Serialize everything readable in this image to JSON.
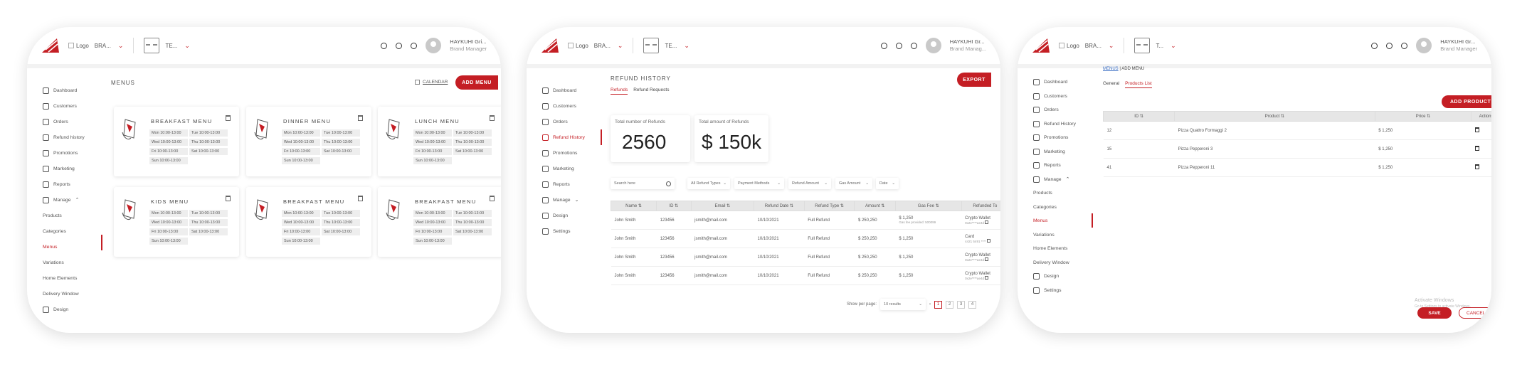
{
  "header": {
    "logo_text": "Logo",
    "brand": "BRA...",
    "brand_short": "BRA...",
    "team": "TE...",
    "team_short": "T...",
    "user_name_1": "HAYKUHI Gri...",
    "user_name_2": "HAYKUHI Gr...",
    "user_name_3": "HAYKUHI Gr...",
    "user_role_1": "Brand Manager",
    "user_role_2": "Brand Manag...",
    "user_role_3": "Brand Manager"
  },
  "sidebar": {
    "dashboard": "Dashboard",
    "customers": "Customers",
    "orders": "Orders",
    "refund_history": "Refund history",
    "refund_history_cap": "Refund History",
    "promotions": "Promotions",
    "marketing": "Marketing",
    "reports": "Reports",
    "manage": "Manage",
    "products": "Products",
    "categories": "Categories",
    "menus": "Menus",
    "variations": "Variations",
    "home_elements": "Home Elements",
    "delivery_window": "Delivery Window",
    "design": "Design",
    "settings": "Settings"
  },
  "menus_screen": {
    "title": "MENUS",
    "calendar": "CALENDAR",
    "add_menu": "ADD MENU",
    "cards": [
      {
        "title": "BREAKFAST MENU",
        "hours": [
          "Mon 10:00-13:00",
          "Tue 10:00-13:00",
          "Wed 10:00-13:00",
          "Thu 10:00-13:00",
          "Fri 10:00-13:00",
          "Sat 10:00-13:00",
          "Sun 10:00-13:00"
        ]
      },
      {
        "title": "DINNER MENU",
        "hours": [
          "Mon 10:00-13:00",
          "Tue 10:00-13:00",
          "Wed 10:00-13:00",
          "Thu 10:00-13:00",
          "Fri 10:00-13:00",
          "Sat 10:00-13:00",
          "Sun 10:00-13:00"
        ]
      },
      {
        "title": "LUNCH MENU",
        "hours": [
          "Mon 10:00-13:00",
          "Tue 10:00-13:00",
          "Wed 10:00-13:00",
          "Thu 10:00-13:00",
          "Fri 10:00-13:00",
          "Sat 10:00-13:00",
          "Sun 10:00-13:00"
        ]
      },
      {
        "title": "KIDS MENU",
        "hours": [
          "Mon 10:00-13:00",
          "Tue 10:00-13:00",
          "Wed 10:00-13:00",
          "Thu 10:00-13:00",
          "Fri 10:00-13:00",
          "Sat 10:00-13:00",
          "Sun 10:00-13:00"
        ]
      },
      {
        "title": "BREAKFAST MENU",
        "hours": [
          "Mon 10:00-13:00",
          "Tue 10:00-13:00",
          "Wed 10:00-13:00",
          "Thu 10:00-13:00",
          "Fri 10:00-13:00",
          "Sat 10:00-13:00",
          "Sun 10:00-13:00"
        ]
      },
      {
        "title": "BREAKFAST MENU",
        "hours": [
          "Mon 10:00-13:00",
          "Tue 10:00-13:00",
          "Wed 10:00-13:00",
          "Thu 10:00-13:00",
          "Fri 10:00-13:00",
          "Sat 10:00-13:00",
          "Sun 10:00-13:00"
        ]
      }
    ]
  },
  "refund_screen": {
    "title": "REFUND HISTORY",
    "export": "EXPORT",
    "tab_refunds": "Refunds",
    "tab_requests": "Refund Requests",
    "total_refunds_label": "Total number of Refunds",
    "total_refunds_value": "2560",
    "total_amount_label": "Total amount of Refunds",
    "total_amount_value": "$ 150k",
    "search_placeholder": "Search here",
    "filters": [
      "All Refund Types",
      "Payment Methods",
      "Refund Amount",
      "Gas Amount",
      "Date"
    ],
    "columns": [
      "Name ⇅",
      "ID ⇅",
      "Email ⇅",
      "Refund Date ⇅",
      "Refund Type ⇅",
      "Amount ⇅",
      "Gas Fee ⇅",
      "Refunded To"
    ],
    "rows": [
      {
        "name": "John Smith",
        "id": "123456",
        "email": "jsmith@mail.com",
        "date": "10/10/2021",
        "type": "Full Refund",
        "amount": "$ 250,250",
        "gas": "$ 1,250",
        "gas_note": "Gas fee provided: 500099",
        "to": "Crypto Wallet",
        "to_note": "0x2e****ae4d"
      },
      {
        "name": "John Smith",
        "id": "123456",
        "email": "jsmith@mail.com",
        "date": "10/10/2021",
        "type": "Full Refund",
        "amount": "$ 250,250",
        "gas": "$ 1,250",
        "gas_note": "",
        "to": "Card",
        "to_note": "4421 5491 ****"
      },
      {
        "name": "John Smith",
        "id": "123456",
        "email": "jsmith@mail.com",
        "date": "10/10/2021",
        "type": "Full Refund",
        "amount": "$ 250,250",
        "gas": "$ 1,250",
        "gas_note": "",
        "to": "Crypto Wallet",
        "to_note": "0x2e****ae4d"
      },
      {
        "name": "John Smith",
        "id": "123456",
        "email": "jsmith@mail.com",
        "date": "10/10/2021",
        "type": "Full Refund",
        "amount": "$ 250,250",
        "gas": "$ 1,250",
        "gas_note": "",
        "to": "Crypto Wallet",
        "to_note": "0x2e****ae4d"
      }
    ],
    "show_per_page": "Show per page:",
    "results": "10 results",
    "pages": [
      "1",
      "2",
      "3",
      "4"
    ]
  },
  "add_menu_screen": {
    "breadcrumb_root": "MENUS",
    "breadcrumb_current": "ADD MENU",
    "tab_general": "General",
    "tab_products": "Products List",
    "add_product": "ADD PRODUCT",
    "columns": [
      "ID ⇅",
      "Product ⇅",
      "Price ⇅",
      "Actions"
    ],
    "rows": [
      {
        "id": "12",
        "product": "Pizza Quattro Formaggi 2",
        "price": "$ 1,250"
      },
      {
        "id": "15",
        "product": "Pizza Pepperoni 3",
        "price": "$ 1,250"
      },
      {
        "id": "41",
        "product": "Pizza Pepperoni 11",
        "price": "$ 1,250"
      }
    ],
    "save": "SAVE",
    "cancel": "CANCEL",
    "watermark_1": "Activate Windows",
    "watermark_2": "Go to Settings to activate Windows."
  },
  "colors": {
    "accent": "#c41e24"
  }
}
